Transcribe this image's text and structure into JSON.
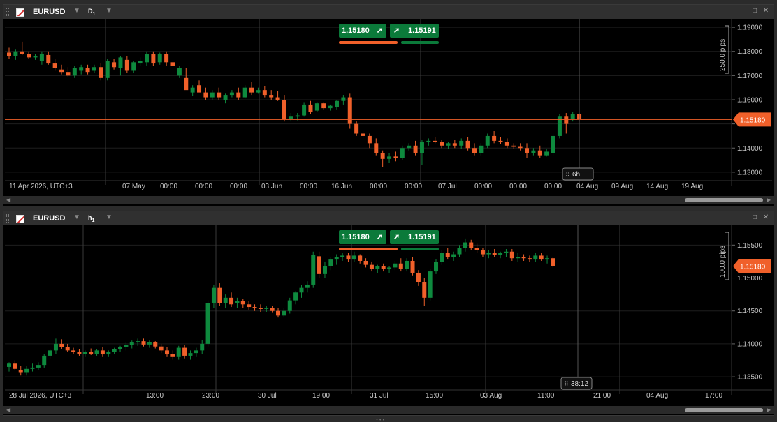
{
  "colors": {
    "bull": "#0e8a3e",
    "bear": "#f0602a",
    "grid": "#1e1e1e",
    "axis_text": "#c8c8c8",
    "price_line_top": "#f0602a",
    "price_line_bottom": "#c9b458"
  },
  "panels": [
    {
      "symbol": "EURUSD",
      "timeframe": "D",
      "timeframe_sub": "1",
      "sell_price": "1.15180",
      "buy_price": "1.15191",
      "current_price_label": "1.15180",
      "range_label": "250.0 pips",
      "countdown_label": "6h",
      "price_ticks": [
        "1.19000",
        "1.18000",
        "1.17000",
        "1.16000",
        "1.15000",
        "1.14000",
        "1.13000"
      ],
      "time_labels": [
        "11 Apr 2026, UTC+3",
        "07 May",
        "00:00",
        "00:00",
        "00:00",
        "03 Jun",
        "00:00",
        "16 Jun",
        "00:00",
        "00:00",
        "07 Jul",
        "00:00",
        "00:00",
        "00:00",
        "04 Aug",
        "09 Aug",
        "14 Aug",
        "19 Aug"
      ]
    },
    {
      "symbol": "EURUSD",
      "timeframe": "h",
      "timeframe_sub": "1",
      "sell_price": "1.15180",
      "buy_price": "1.15191",
      "current_price_label": "1.15180",
      "range_label": "100.0 pips",
      "countdown_label": "38:12",
      "price_ticks": [
        "1.15500",
        "1.15000",
        "1.14500",
        "1.14000",
        "1.13500"
      ],
      "time_labels": [
        "28 Jul 2026, UTC+3",
        "13:00",
        "23:00",
        "30 Jul",
        "19:00",
        "31 Jul",
        "15:00",
        "03 Aug",
        "11:00",
        "21:00",
        "04 Aug",
        "17:00"
      ]
    }
  ],
  "chart_data": [
    {
      "type": "candlestick",
      "title": "EURUSD D1",
      "ylim": [
        1.1265,
        1.1935
      ],
      "current": 1.1518,
      "candles": [
        [
          1.1795,
          1.1815,
          1.177,
          1.178
        ],
        [
          1.178,
          1.181,
          1.1765,
          1.18
        ],
        [
          1.18,
          1.184,
          1.1785,
          1.179
        ],
        [
          1.179,
          1.18,
          1.177,
          1.1775
        ],
        [
          1.1775,
          1.179,
          1.1765,
          1.178
        ],
        [
          1.176,
          1.18,
          1.1745,
          1.179
        ],
        [
          1.1785,
          1.18,
          1.1745,
          1.175
        ],
        [
          1.175,
          1.177,
          1.172,
          1.173
        ],
        [
          1.1725,
          1.1745,
          1.1705,
          1.1715
        ],
        [
          1.1715,
          1.1735,
          1.1695,
          1.17
        ],
        [
          1.17,
          1.174,
          1.169,
          1.173
        ],
        [
          1.172,
          1.1745,
          1.1705,
          1.1735
        ],
        [
          1.173,
          1.1745,
          1.1705,
          1.1715
        ],
        [
          1.172,
          1.1745,
          1.171,
          1.1735
        ],
        [
          1.1735,
          1.175,
          1.168,
          1.169
        ],
        [
          1.169,
          1.177,
          1.168,
          1.176
        ],
        [
          1.1755,
          1.177,
          1.1725,
          1.1735
        ],
        [
          1.173,
          1.178,
          1.17,
          1.1775
        ],
        [
          1.1765,
          1.178,
          1.171,
          1.172
        ],
        [
          1.172,
          1.176,
          1.171,
          1.1755
        ],
        [
          1.175,
          1.1775,
          1.174,
          1.176
        ],
        [
          1.1755,
          1.18,
          1.174,
          1.179
        ],
        [
          1.179,
          1.18,
          1.174,
          1.175
        ],
        [
          1.1755,
          1.1795,
          1.1745,
          1.179
        ],
        [
          1.179,
          1.18,
          1.174,
          1.1755
        ],
        [
          1.1755,
          1.177,
          1.173,
          1.174
        ],
        [
          1.17,
          1.174,
          1.169,
          1.173
        ],
        [
          1.169,
          1.173,
          1.167,
          1.164
        ],
        [
          1.163,
          1.166,
          1.1615,
          1.165
        ],
        [
          1.166,
          1.168,
          1.164,
          1.163
        ],
        [
          1.163,
          1.165,
          1.16,
          1.161
        ],
        [
          1.161,
          1.164,
          1.16,
          1.163
        ],
        [
          1.163,
          1.165,
          1.16,
          1.161
        ],
        [
          1.16,
          1.1625,
          1.1585,
          1.162
        ],
        [
          1.162,
          1.164,
          1.161,
          1.163
        ],
        [
          1.163,
          1.165,
          1.16,
          1.161
        ],
        [
          1.161,
          1.166,
          1.1605,
          1.165
        ],
        [
          1.165,
          1.1675,
          1.162,
          1.163
        ],
        [
          1.163,
          1.165,
          1.1625,
          1.164
        ],
        [
          1.164,
          1.1655,
          1.161,
          1.162
        ],
        [
          1.162,
          1.164,
          1.16,
          1.161
        ],
        [
          1.161,
          1.1635,
          1.1595,
          1.16
        ],
        [
          1.16,
          1.162,
          1.151,
          1.152
        ],
        [
          1.152,
          1.1545,
          1.151,
          1.153
        ],
        [
          1.153,
          1.1545,
          1.1515,
          1.1535
        ],
        [
          1.1535,
          1.159,
          1.153,
          1.158
        ],
        [
          1.158,
          1.1595,
          1.154,
          1.155
        ],
        [
          1.1555,
          1.159,
          1.155,
          1.1585
        ],
        [
          1.1585,
          1.159,
          1.156,
          1.1565
        ],
        [
          1.1565,
          1.158,
          1.1555,
          1.1575
        ],
        [
          1.157,
          1.16,
          1.156,
          1.1595
        ],
        [
          1.1595,
          1.162,
          1.158,
          1.161
        ],
        [
          1.161,
          1.1625,
          1.148,
          1.15
        ],
        [
          1.15,
          1.151,
          1.145,
          1.146
        ],
        [
          1.146,
          1.147,
          1.144,
          1.145
        ],
        [
          1.145,
          1.146,
          1.14,
          1.142
        ],
        [
          1.142,
          1.144,
          1.137,
          1.138
        ],
        [
          1.138,
          1.139,
          1.132,
          1.1355
        ],
        [
          1.1355,
          1.138,
          1.134,
          1.1365
        ],
        [
          1.1365,
          1.1385,
          1.1345,
          1.136
        ],
        [
          1.136,
          1.141,
          1.135,
          1.14
        ],
        [
          1.14,
          1.142,
          1.139,
          1.141
        ],
        [
          1.141,
          1.143,
          1.137,
          1.138
        ],
        [
          1.138,
          1.1435,
          1.133,
          1.1425
        ],
        [
          1.1425,
          1.144,
          1.141,
          1.143
        ],
        [
          1.143,
          1.1445,
          1.142,
          1.1425
        ],
        [
          1.1425,
          1.1435,
          1.14,
          1.141
        ],
        [
          1.141,
          1.1425,
          1.1395,
          1.142
        ],
        [
          1.142,
          1.1435,
          1.14,
          1.141
        ],
        [
          1.141,
          1.144,
          1.1395,
          1.143
        ],
        [
          1.143,
          1.1445,
          1.139,
          1.14
        ],
        [
          1.14,
          1.142,
          1.137,
          1.138
        ],
        [
          1.138,
          1.142,
          1.137,
          1.141
        ],
        [
          1.141,
          1.146,
          1.14,
          1.145
        ],
        [
          1.145,
          1.147,
          1.142,
          1.143
        ],
        [
          1.143,
          1.1445,
          1.1415,
          1.1425
        ],
        [
          1.1425,
          1.144,
          1.14,
          1.141
        ],
        [
          1.141,
          1.142,
          1.1395,
          1.1405
        ],
        [
          1.1405,
          1.142,
          1.139,
          1.14
        ],
        [
          1.14,
          1.142,
          1.136,
          1.138
        ],
        [
          1.138,
          1.14,
          1.137,
          1.139
        ],
        [
          1.139,
          1.141,
          1.136,
          1.137
        ],
        [
          1.137,
          1.1395,
          1.1365,
          1.1385
        ],
        [
          1.138,
          1.146,
          1.137,
          1.145
        ],
        [
          1.145,
          1.154,
          1.144,
          1.153
        ],
        [
          1.153,
          1.1545,
          1.146,
          1.15
        ],
        [
          1.152,
          1.155,
          1.151,
          1.154
        ],
        [
          1.154,
          1.1545,
          1.151,
          1.1518
        ]
      ]
    },
    {
      "type": "candlestick",
      "title": "EURUSD h1",
      "ylim": [
        1.133,
        1.158
      ],
      "current": 1.1518,
      "candles": [
        [
          1.1365,
          1.1372,
          1.1358,
          1.137
        ],
        [
          1.137,
          1.1375,
          1.136,
          1.1362
        ],
        [
          1.136,
          1.1367,
          1.1352,
          1.1356
        ],
        [
          1.1356,
          1.1366,
          1.1352,
          1.1362
        ],
        [
          1.1362,
          1.137,
          1.1358,
          1.1364
        ],
        [
          1.1364,
          1.1372,
          1.136,
          1.1368
        ],
        [
          1.1368,
          1.1384,
          1.1364,
          1.1382
        ],
        [
          1.1382,
          1.1392,
          1.1378,
          1.139
        ],
        [
          1.139,
          1.1408,
          1.1385,
          1.14
        ],
        [
          1.14,
          1.1407,
          1.1392,
          1.1395
        ],
        [
          1.1395,
          1.14,
          1.1388,
          1.139
        ],
        [
          1.139,
          1.1394,
          1.1385,
          1.1388
        ],
        [
          1.1388,
          1.1392,
          1.1382,
          1.1385
        ],
        [
          1.1385,
          1.139,
          1.138,
          1.1388
        ],
        [
          1.1388,
          1.1393,
          1.1383,
          1.1385
        ],
        [
          1.1385,
          1.1392,
          1.1382,
          1.139
        ],
        [
          1.139,
          1.1395,
          1.138,
          1.1384
        ],
        [
          1.1384,
          1.139,
          1.138,
          1.1388
        ],
        [
          1.1388,
          1.1394,
          1.1385,
          1.1392
        ],
        [
          1.1392,
          1.1397,
          1.1388,
          1.1395
        ],
        [
          1.1395,
          1.1402,
          1.139,
          1.1398
        ],
        [
          1.1398,
          1.1405,
          1.1393,
          1.1402
        ],
        [
          1.1402,
          1.1408,
          1.1397,
          1.1404
        ],
        [
          1.1404,
          1.1408,
          1.1396,
          1.1399
        ],
        [
          1.1399,
          1.1405,
          1.1394,
          1.1402
        ],
        [
          1.1402,
          1.1404,
          1.1393,
          1.1396
        ],
        [
          1.1396,
          1.14,
          1.1386,
          1.139
        ],
        [
          1.139,
          1.1395,
          1.138,
          1.1384
        ],
        [
          1.1384,
          1.139,
          1.1376,
          1.138
        ],
        [
          1.138,
          1.1397,
          1.1376,
          1.1394
        ],
        [
          1.1394,
          1.1398,
          1.1378,
          1.1382
        ],
        [
          1.1382,
          1.139,
          1.1376,
          1.1386
        ],
        [
          1.1386,
          1.1394,
          1.138,
          1.139
        ],
        [
          1.139,
          1.1406,
          1.1384,
          1.14
        ],
        [
          1.14,
          1.1466,
          1.1396,
          1.1462
        ],
        [
          1.1462,
          1.149,
          1.1455,
          1.1485
        ],
        [
          1.1485,
          1.1492,
          1.1458,
          1.1462
        ],
        [
          1.1462,
          1.1475,
          1.1455,
          1.147
        ],
        [
          1.147,
          1.1478,
          1.1456,
          1.146
        ],
        [
          1.1462,
          1.147,
          1.1455,
          1.1465
        ],
        [
          1.1465,
          1.1468,
          1.1455,
          1.146
        ],
        [
          1.146,
          1.1465,
          1.1452,
          1.1456
        ],
        [
          1.1456,
          1.146,
          1.145,
          1.1454
        ],
        [
          1.1454,
          1.146,
          1.1448,
          1.1453
        ],
        [
          1.1453,
          1.1458,
          1.1448,
          1.1455
        ],
        [
          1.1455,
          1.1458,
          1.1447,
          1.145
        ],
        [
          1.145,
          1.1455,
          1.144,
          1.1443
        ],
        [
          1.1443,
          1.1454,
          1.144,
          1.145
        ],
        [
          1.145,
          1.147,
          1.1446,
          1.1466
        ],
        [
          1.1466,
          1.148,
          1.146,
          1.1478
        ],
        [
          1.1478,
          1.149,
          1.147,
          1.1485
        ],
        [
          1.1485,
          1.1495,
          1.1478,
          1.149
        ],
        [
          1.149,
          1.154,
          1.1485,
          1.1535
        ],
        [
          1.1533,
          1.154,
          1.15,
          1.1506
        ],
        [
          1.1506,
          1.1525,
          1.15,
          1.1518
        ],
        [
          1.1518,
          1.1532,
          1.1512,
          1.1528
        ],
        [
          1.1528,
          1.1536,
          1.152,
          1.1532
        ],
        [
          1.1532,
          1.1538,
          1.1526,
          1.1534
        ],
        [
          1.1534,
          1.1538,
          1.1524,
          1.1528
        ],
        [
          1.1528,
          1.154,
          1.1524,
          1.1534
        ],
        [
          1.1534,
          1.1536,
          1.1522,
          1.1526
        ],
        [
          1.1526,
          1.153,
          1.1516,
          1.152
        ],
        [
          1.152,
          1.1525,
          1.151,
          1.1514
        ],
        [
          1.1514,
          1.152,
          1.1508,
          1.1518
        ],
        [
          1.1518,
          1.1522,
          1.151,
          1.1514
        ],
        [
          1.1514,
          1.1518,
          1.1508,
          1.1516
        ],
        [
          1.1516,
          1.1526,
          1.1512,
          1.1522
        ],
        [
          1.1522,
          1.153,
          1.151,
          1.1514
        ],
        [
          1.1514,
          1.153,
          1.151,
          1.1526
        ],
        [
          1.1526,
          1.1532,
          1.1504,
          1.1508
        ],
        [
          1.1508,
          1.1512,
          1.1488,
          1.1494
        ],
        [
          1.1494,
          1.15,
          1.1458,
          1.147
        ],
        [
          1.147,
          1.1514,
          1.1466,
          1.151
        ],
        [
          1.151,
          1.1528,
          1.1506,
          1.1524
        ],
        [
          1.1524,
          1.1542,
          1.152,
          1.1538
        ],
        [
          1.1538,
          1.1546,
          1.1528,
          1.1532
        ],
        [
          1.1532,
          1.154,
          1.1526,
          1.1536
        ],
        [
          1.1536,
          1.155,
          1.1532,
          1.1546
        ],
        [
          1.1546,
          1.156,
          1.154,
          1.1554
        ],
        [
          1.1554,
          1.1558,
          1.1542,
          1.1546
        ],
        [
          1.1546,
          1.1552,
          1.1538,
          1.1542
        ],
        [
          1.1542,
          1.1546,
          1.1532,
          1.1536
        ],
        [
          1.1536,
          1.1542,
          1.153,
          1.1538
        ],
        [
          1.1538,
          1.1544,
          1.1532,
          1.1535
        ],
        [
          1.1535,
          1.154,
          1.153,
          1.1538
        ],
        [
          1.1538,
          1.1544,
          1.1532,
          1.154
        ],
        [
          1.154,
          1.1544,
          1.1526,
          1.153
        ],
        [
          1.153,
          1.1538,
          1.1524,
          1.1532
        ],
        [
          1.1532,
          1.1536,
          1.1526,
          1.153
        ],
        [
          1.153,
          1.1534,
          1.1524,
          1.1528
        ],
        [
          1.1528,
          1.1538,
          1.1524,
          1.1534
        ],
        [
          1.1534,
          1.1538,
          1.1526,
          1.1528
        ],
        [
          1.1528,
          1.1534,
          1.1522,
          1.153
        ],
        [
          1.153,
          1.1532,
          1.1516,
          1.1518
        ]
      ]
    }
  ]
}
